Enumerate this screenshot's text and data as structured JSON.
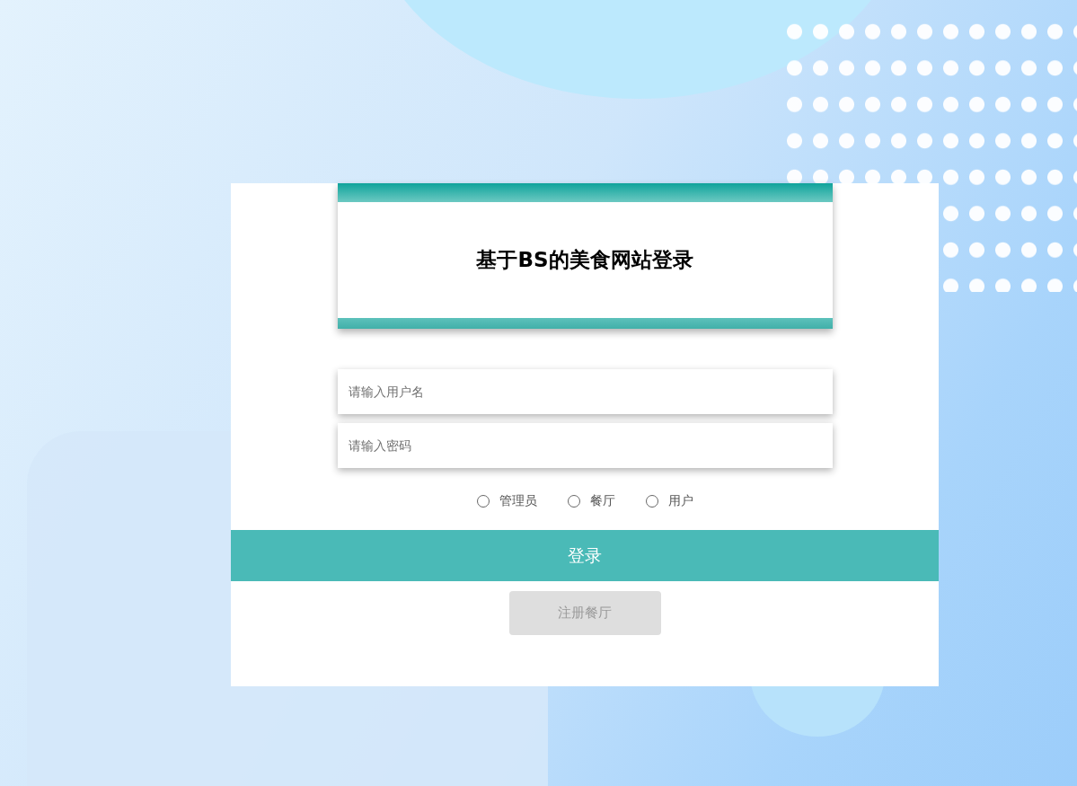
{
  "header": {
    "title": "基于BS的美食网站登录"
  },
  "fields": [
    {
      "placeholder": "请输入用户名"
    },
    {
      "placeholder": "请输入密码"
    }
  ],
  "roles": [
    {
      "label": "管理员",
      "selected": false
    },
    {
      "label": "餐厅",
      "selected": false
    },
    {
      "label": "用户",
      "selected": false
    }
  ],
  "login_button": "登录",
  "register_button": "注册餐厅"
}
